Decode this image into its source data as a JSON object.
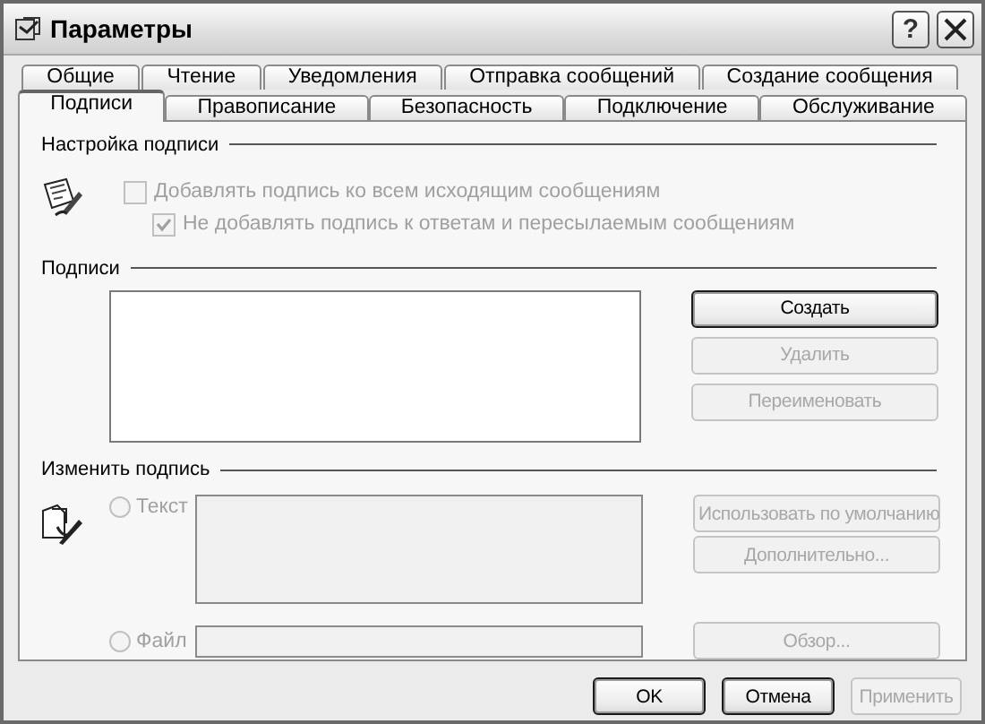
{
  "window": {
    "title": "Параметры",
    "help_button": "?"
  },
  "tab_rows": [
    {
      "tabs": [
        {
          "label": "Общие",
          "selected": false
        },
        {
          "label": "Чтение",
          "selected": false
        },
        {
          "label": "Уведомления",
          "selected": false
        },
        {
          "label": "Отправка сообщений",
          "selected": false
        },
        {
          "label": "Создание сообщения",
          "selected": false
        }
      ]
    },
    {
      "tabs": [
        {
          "label": "Подписи",
          "selected": true
        },
        {
          "label": "Правописание",
          "selected": false
        },
        {
          "label": "Безопасность",
          "selected": false
        },
        {
          "label": "Подключение",
          "selected": false
        },
        {
          "label": "Обслуживание",
          "selected": false
        }
      ]
    }
  ],
  "signature_settings": {
    "heading": "Настройка подписи",
    "checkboxes": [
      {
        "label": "Добавлять подпись ко всем исходящим сообщениям",
        "checked": false,
        "disabled": true
      },
      {
        "label": "Не добавлять подпись к ответам и пересылаемым сообщениям",
        "checked": true,
        "disabled": true
      }
    ]
  },
  "signatures": {
    "heading": "Подписи",
    "buttons": [
      {
        "label": "Создать",
        "disabled": false,
        "default": true
      },
      {
        "label": "Удалить",
        "disabled": true,
        "default": false
      },
      {
        "label": "Переименовать",
        "disabled": true,
        "default": false
      }
    ]
  },
  "edit_signature": {
    "heading": "Изменить подпись",
    "options": [
      {
        "label": "Текст",
        "selected": false,
        "disabled": true
      },
      {
        "label": "Файл",
        "selected": false,
        "disabled": true
      }
    ],
    "buttons": [
      {
        "label": "Использовать по умолчанию",
        "disabled": true,
        "default": false
      },
      {
        "label": "Дополнительно...",
        "disabled": true,
        "default": false
      },
      {
        "label": "Обзор...",
        "disabled": true,
        "default": false
      }
    ]
  },
  "footer_buttons": [
    {
      "label": "OK",
      "disabled": false,
      "default": true
    },
    {
      "label": "Отмена",
      "disabled": false,
      "default": true
    },
    {
      "label": "Применить",
      "disabled": true,
      "default": false
    }
  ]
}
